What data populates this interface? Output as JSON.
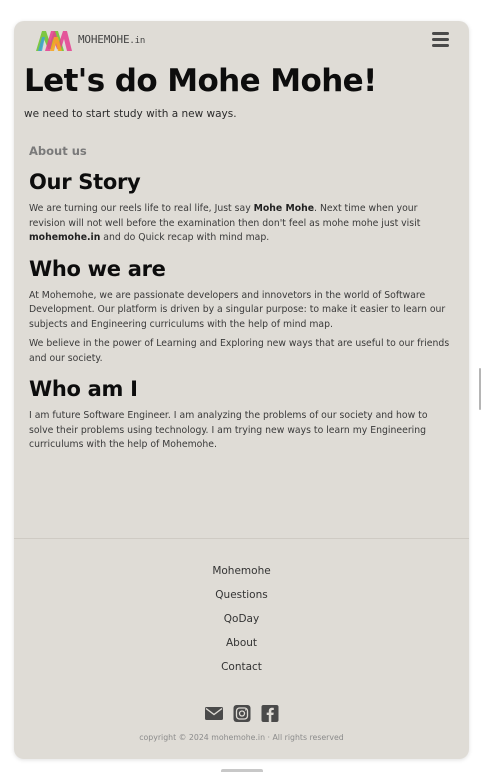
{
  "header": {
    "logo_text": "MOHEMOHE",
    "logo_suffix": ".in",
    "menu_icon": "hamburger-menu-icon"
  },
  "hero": {
    "title": "Let's do Mohe Mohe!",
    "subtitle": "we need to start study with a new ways."
  },
  "main": {
    "about_label": "About us",
    "our_story": {
      "title": "Our Story",
      "p1_part1": "We are turning our reels life to real life, Just say ",
      "p1_bold1": "Mohe Mohe",
      "p1_part2": ". Next time when your revision will not well before the examination then don't feel as mohe mohe just visit ",
      "p1_bold2": "mohemohe.in",
      "p1_part3": " and do Quick recap with mind map."
    },
    "who_we_are": {
      "title": "Who we are",
      "p1": "At Mohemohe, we are passionate developers and innovetors in the world of Software Development. Our platform is driven by a singular purpose: to make it easier to learn our subjects and Engineering curriculums with the help of mind map.",
      "p2": "We believe in the power of Learning and Exploring new ways that are useful to our friends and our society."
    },
    "who_am_i": {
      "title": "Who am I",
      "p1": "I am future Software Engineer. I am analyzing the problems of our society and how to solve their problems using technology. I am trying new ways to learn my Engineering curriculums with the help of Mohemohe."
    }
  },
  "footer": {
    "links": [
      "Mohemohe",
      "Questions",
      "QoDay",
      "About",
      "Contact"
    ],
    "socials": [
      "email-icon",
      "instagram-icon",
      "facebook-icon"
    ],
    "copyright": "copyright © 2024 mohemohe.in · All rights reserved"
  },
  "colors": {
    "card_bg": "#dfdcd6",
    "text_dark": "#0d0d0d",
    "muted": "#7a7a7a"
  }
}
